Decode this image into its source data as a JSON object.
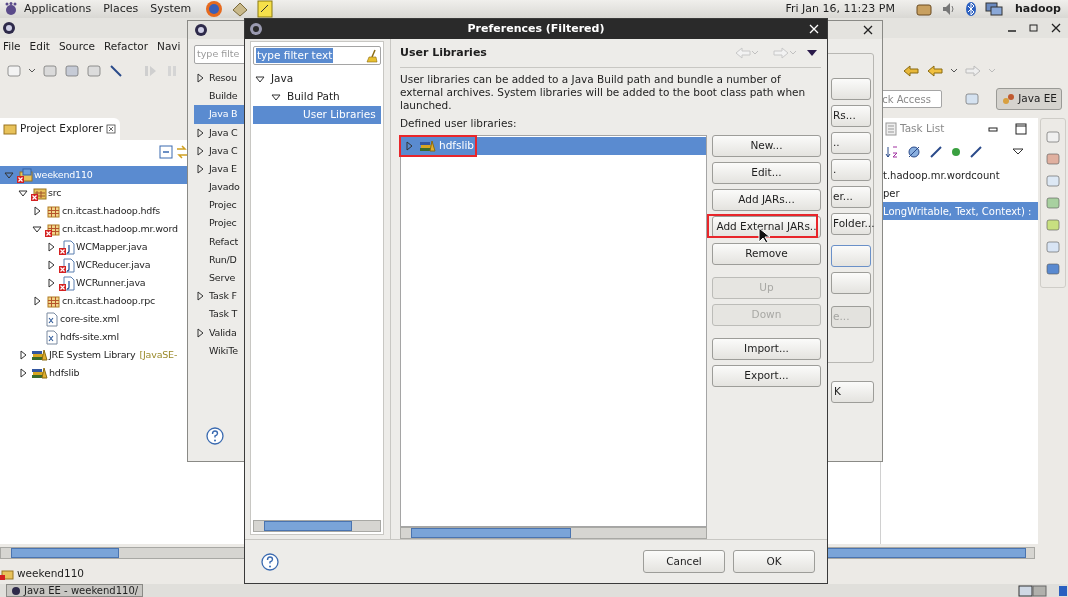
{
  "top_panel": {
    "menus": [
      "Applications",
      "Places",
      "System"
    ],
    "clock": "Fri Jan 16, 11:23 PM",
    "user": "hadoop"
  },
  "eclipse": {
    "menu": [
      "File",
      "Edit",
      "Source",
      "Refactor",
      "Navi"
    ],
    "quick_access": {
      "placeholder": "ck Access"
    },
    "perspective": {
      "label": "Java EE"
    },
    "project_explorer": {
      "title": "Project Explorer",
      "tree": [
        {
          "label": "weekend110",
          "kind": "project",
          "error": true,
          "expanded": true,
          "selected": true,
          "children": [
            {
              "label": "src",
              "kind": "source",
              "error": true,
              "expanded": true,
              "selected": false,
              "children": [
                {
                  "label": "cn.itcast.hadoop.hdfs",
                  "kind": "package",
                  "error": false,
                  "expanded": false,
                  "selected": false
                },
                {
                  "label": "cn.itcast.hadoop.mr.word",
                  "kind": "package",
                  "error": true,
                  "expanded": true,
                  "selected": false,
                  "children": [
                    {
                      "label": "WCMapper.java",
                      "kind": "java",
                      "error": true,
                      "expanded": false,
                      "selected": false
                    },
                    {
                      "label": "WCReducer.java",
                      "kind": "java",
                      "error": true,
                      "expanded": false,
                      "selected": false
                    },
                    {
                      "label": "WCRunner.java",
                      "kind": "java",
                      "error": true,
                      "expanded": false,
                      "selected": false
                    }
                  ]
                },
                {
                  "label": "cn.itcast.hadoop.rpc",
                  "kind": "package",
                  "error": false,
                  "expanded": false,
                  "selected": false
                },
                {
                  "label": "core-site.xml",
                  "kind": "xml",
                  "error": false,
                  "selected": false
                },
                {
                  "label": "hdfs-site.xml",
                  "kind": "xml",
                  "error": false,
                  "selected": false
                }
              ]
            },
            {
              "label": "JRE System Library",
              "decoration": "[JavaSE-",
              "kind": "library",
              "error": false,
              "expanded": false,
              "selected": false
            },
            {
              "label": "hdfslib",
              "kind": "library",
              "error": false,
              "expanded": false,
              "selected": false
            }
          ]
        }
      ]
    },
    "task_list": {
      "title": "Task List",
      "rows": [
        {
          "text": "t.hadoop.mr.wordcount",
          "selected": false
        },
        {
          "text": "per",
          "selected": false
        },
        {
          "text": "LongWritable, Text, Context) :",
          "selected": true
        }
      ]
    },
    "status": "weekend110",
    "taskbar": [
      {
        "label": "Java EE - weekend110/"
      }
    ]
  },
  "properties_dialog": {
    "filter": {
      "placeholder": "type filte"
    },
    "items": [
      {
        "label": "Resou",
        "expanded": false,
        "selected": false
      },
      {
        "label": "Builde",
        "selected": false
      },
      {
        "label": "Java B",
        "selected": true
      },
      {
        "label": "Java C",
        "expanded": false,
        "selected": false
      },
      {
        "label": "Java C",
        "expanded": false,
        "selected": false
      },
      {
        "label": "Java E",
        "expanded": false,
        "selected": false
      },
      {
        "label": "Javado",
        "selected": false
      },
      {
        "label": "Projec",
        "selected": false
      },
      {
        "label": "Projec",
        "selected": false
      },
      {
        "label": "Refact",
        "selected": false
      },
      {
        "label": "Run/D",
        "selected": false
      },
      {
        "label": "Serve",
        "selected": false
      },
      {
        "label": "Task F",
        "expanded": false,
        "selected": false
      },
      {
        "label": "Task T",
        "selected": false
      },
      {
        "label": "Valida",
        "expanded": false,
        "selected": false
      },
      {
        "label": "WikiTe",
        "selected": false
      }
    ],
    "button_groups": [
      [
        {
          "disabled": false,
          "focused": false
        },
        {
          "label": "Rs...",
          "disabled": false,
          "focused": false
        },
        {
          "label": "..",
          "disabled": false,
          "focused": false
        },
        {
          "label": ".",
          "disabled": false,
          "focused": false
        },
        {
          "label": "er...",
          "disabled": false,
          "focused": false
        },
        {
          "label": "Folder...",
          "disabled": false,
          "focused": false
        }
      ],
      [
        {
          "disabled": false,
          "focused": true
        },
        {
          "disabled": false,
          "focused": false
        }
      ],
      [
        {
          "label": "e...",
          "disabled": true,
          "focused": false
        }
      ]
    ],
    "ok": "K"
  },
  "preferences_dialog": {
    "title": "Preferences (Filtered)",
    "filter": {
      "value": "type filter text"
    },
    "tree": [
      {
        "label": "Java",
        "expanded": true,
        "selected": false,
        "children": [
          {
            "label": "Build Path",
            "expanded": true,
            "selected": false,
            "children": [
              {
                "label": "User Libraries",
                "selected": true
              }
            ]
          }
        ]
      }
    ],
    "page_title": "User Libraries",
    "description": "User libraries can be added to a Java Build path and bundle a number of external archives. System libraries will be added to the boot class path when launched.",
    "list_label": "Defined user libraries:",
    "libraries": [
      {
        "label": "hdfslib",
        "expanded": false,
        "selected": true,
        "highlighted": true
      }
    ],
    "button_groups": [
      [
        {
          "label": "New...",
          "disabled": false,
          "highlighted": false
        },
        {
          "label": "Edit...",
          "disabled": false,
          "highlighted": false
        },
        {
          "label": "Add JARs...",
          "disabled": false,
          "highlighted": false
        },
        {
          "label": "Add External JARs..",
          "disabled": false,
          "highlighted": true
        },
        {
          "label": "Remove",
          "disabled": false,
          "highlighted": false
        }
      ],
      [
        {
          "label": "Up",
          "disabled": true,
          "highlighted": false
        },
        {
          "label": "Down",
          "disabled": true,
          "highlighted": false
        }
      ],
      [
        {
          "label": "Import...",
          "disabled": false,
          "highlighted": false
        },
        {
          "label": "Export...",
          "disabled": false,
          "highlighted": false
        }
      ]
    ],
    "footer_buttons": [
      "Cancel",
      "OK"
    ]
  }
}
